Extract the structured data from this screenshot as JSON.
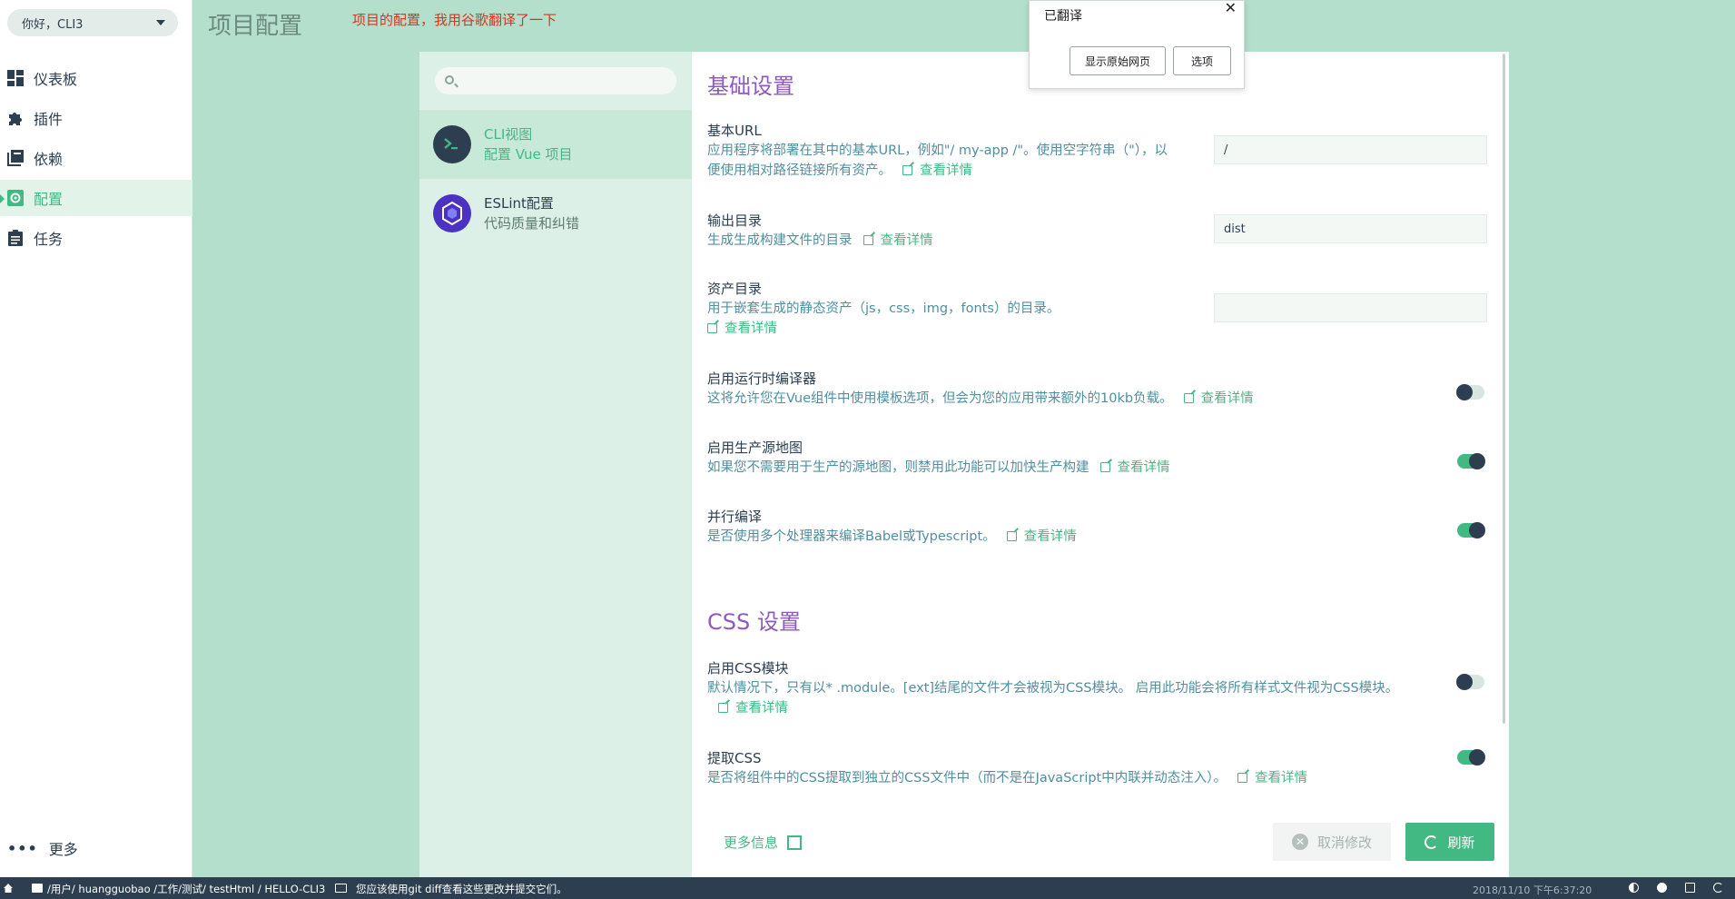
{
  "nav": {
    "project_select": "你好，CLI3",
    "items": [
      {
        "label": "仪表板",
        "icon": "dashboard-icon",
        "active": false
      },
      {
        "label": "插件",
        "icon": "puzzle-icon",
        "active": false
      },
      {
        "label": "依赖",
        "icon": "library-books-icon",
        "active": false
      },
      {
        "label": "配置",
        "icon": "settings-icon",
        "active": true
      },
      {
        "label": "任务",
        "icon": "clipboard-icon",
        "active": false
      }
    ],
    "more_label": "更多"
  },
  "header": {
    "title": "项目配置",
    "annotation": "项目的配置，我用谷歌翻译了一下"
  },
  "translate_popup": {
    "title": "已翻译",
    "show_original": "显示原始网页",
    "options": "选项"
  },
  "subnav": {
    "search_placeholder": "",
    "items": [
      {
        "title": "CLI视图",
        "subtitle": "配置 Vue 项目",
        "icon": "terminal-icon",
        "active": true
      },
      {
        "title": "ESLint配置",
        "subtitle": "代码质量和纠错",
        "icon": "eslint-icon",
        "active": false
      }
    ]
  },
  "sections": {
    "basic_title": "基础设置",
    "css_title": "CSS 设置"
  },
  "settings": {
    "base_url": {
      "name": "基本URL",
      "desc": "应用程序将部署在其中的基本URL，例如\"/ my-app /\"。使用空字符串（\"），以便使用相对路径链接所有资产。",
      "link": "查看详情",
      "value": "/"
    },
    "output_dir": {
      "name": "输出目录",
      "desc": "生成生成构建文件的目录",
      "link": "查看详情",
      "value": "dist"
    },
    "assets_dir": {
      "name": "资产目录",
      "desc": "用于嵌套生成的静态资产（js，css，img，fonts）的目录。",
      "link": "查看详情",
      "value": ""
    },
    "runtime_compiler": {
      "name": "启用运行时编译器",
      "desc": "这将允许您在Vue组件中使用模板选项，但会为您的应用带来额外的10kb负载。",
      "link": "查看详情",
      "on": false
    },
    "source_map": {
      "name": "启用生产源地图",
      "desc": "如果您不需要用于生产的源地图，则禁用此功能可以加快生产构建",
      "link": "查看详情",
      "on": true
    },
    "parallel": {
      "name": "并行编译",
      "desc": "是否使用多个处理器来编译Babel或Typescript。",
      "link": "查看详情",
      "on": true
    },
    "css_modules": {
      "name": "启用CSS模块",
      "desc": "默认情况下，只有以* .module。[ext]结尾的文件才会被视为CSS模块。 启用此功能会将所有样式文件视为CSS模块。",
      "link": "查看详情",
      "on": false
    },
    "extract_css": {
      "name": "提取CSS",
      "desc": "是否将组件中的CSS提取到独立的CSS文件中（而不是在JavaScript中内联并动态注入）。",
      "link": "查看详情",
      "on": true
    }
  },
  "footer": {
    "more_info": "更多信息",
    "cancel": "取消修改",
    "refresh": "刷新"
  },
  "statusbar": {
    "path": "/用户/ huangguobao /工作/测试/ testHtml / HELLO-CLI3",
    "message": "您应该使用git diff查看这些更改并提交它们。",
    "time": "2018/11/10 下午6:37:20"
  },
  "colors": {
    "accent": "#42b983",
    "dark": "#2c3e50",
    "section_title": "#8e5ac2",
    "page_bg": "#b3dfcc"
  }
}
